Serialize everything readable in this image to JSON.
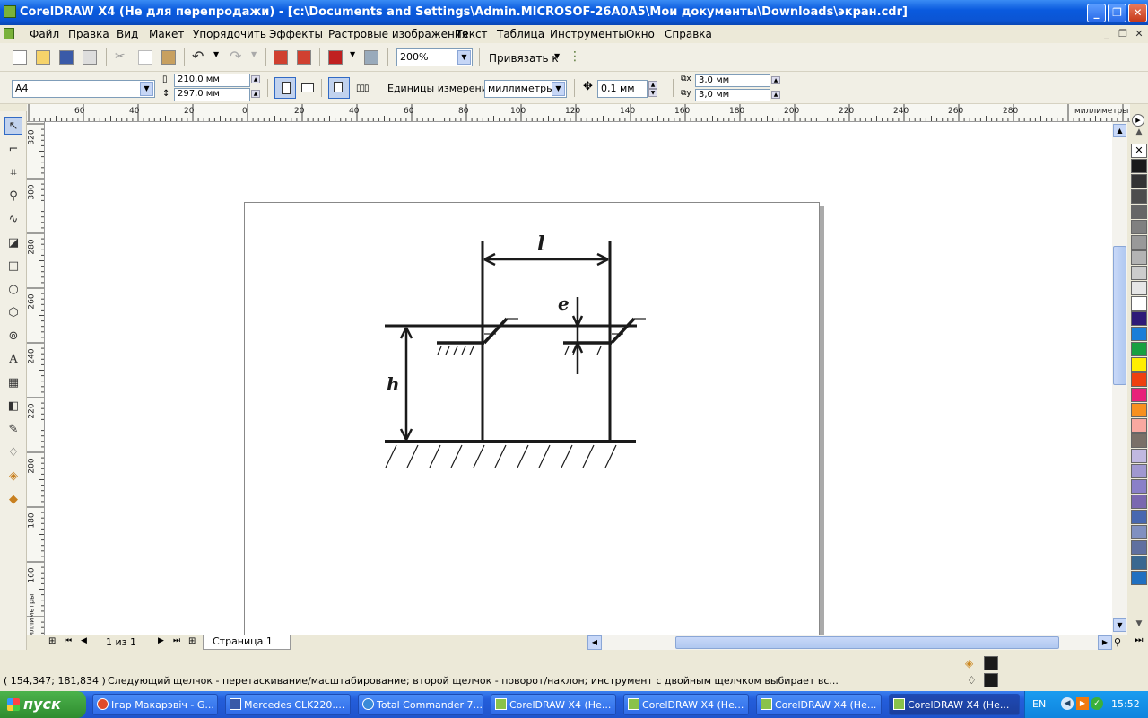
{
  "window": {
    "title": "CorelDRAW X4 (Не для перепродажи) - [c:\\Documents and Settings\\Admin.MICROSOF-26A0A5\\Мои документы\\Downloads\\экран.cdr]"
  },
  "menu": [
    "Файл",
    "Правка",
    "Вид",
    "Макет",
    "Упорядочить",
    "Эффекты",
    "Растровые изображения",
    "Текст",
    "Таблица",
    "Инструменты",
    "Окно",
    "Справка"
  ],
  "toolbar": {
    "zoom": "200%",
    "snap_label": "Привязать к"
  },
  "propbar": {
    "paper": "A4",
    "width": "210,0 мм",
    "height": "297,0 мм",
    "units_label": "Единицы измерения:",
    "units": "миллиметры",
    "nudge": "0,1 мм",
    "dup_x": "3,0 мм",
    "dup_y": "3,0 мм"
  },
  "ruler": {
    "h_ticks": [
      "60",
      "40",
      "20",
      "0",
      "20",
      "40",
      "60",
      "80",
      "100",
      "120",
      "140",
      "160",
      "180",
      "200",
      "220",
      "240",
      "260",
      "280"
    ],
    "h_unit": "миллиметры",
    "v_ticks": [
      "320",
      "300",
      "280",
      "260",
      "240",
      "220",
      "200",
      "180",
      "160"
    ],
    "v_unit": "миллиметры"
  },
  "drawing": {
    "label_l": "l",
    "label_e": "e",
    "label_h": "h"
  },
  "pagenav": {
    "counter": "1 из 1",
    "tab": "Страница 1"
  },
  "status": {
    "coords": "( 154,347; 181,834 )",
    "message": "Следующий щелчок - перетаскивание/масштабирование; второй щелчок - поворот/наклон; инструмент с двойным щелчком выбирает вс..."
  },
  "palette": [
    "#ffffff",
    "#1a1a1a",
    "#333333",
    "#4d4d4d",
    "#666666",
    "#808080",
    "#999999",
    "#b3b3b3",
    "#cccccc",
    "#e6e6e6",
    "#ffffff",
    "#2e1a78",
    "#1a7ed8",
    "#18a040",
    "#ffee00",
    "#ee4010",
    "#e8207a",
    "#f89020",
    "#f8a8a0",
    "#7a7068",
    "#c0b8e0",
    "#a098d0",
    "#8a80c8",
    "#7a68b0",
    "#4868b0",
    "#8090c0",
    "#6070a0",
    "#3a6890",
    "#2070c0"
  ],
  "taskbar": {
    "start": "пуск",
    "items": [
      "Ігар Макарэвіч - G...",
      "Mercedes CLK220....",
      "Total Commander 7....",
      "CorelDRAW X4 (Не...",
      "CorelDRAW X4 (Не...",
      "CorelDRAW X4 (Не...",
      "CorelDRAW X4 (Не..."
    ],
    "lang": "EN",
    "clock": "15:52"
  }
}
